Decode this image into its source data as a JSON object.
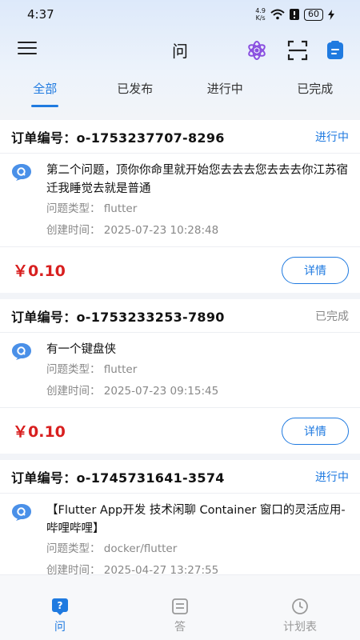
{
  "status_bar": {
    "time": "4:37",
    "net_speed_value": "4.9",
    "net_speed_unit": "K/s",
    "battery": "60"
  },
  "header": {
    "title": "问"
  },
  "tabs": [
    {
      "label": "全部",
      "active": true
    },
    {
      "label": "已发布",
      "active": false
    },
    {
      "label": "进行中",
      "active": false
    },
    {
      "label": "已完成",
      "active": false
    }
  ],
  "orders": [
    {
      "order_label": "订单编号：o-1753237707-8296",
      "status": "进行中",
      "title": "第二个问题，顶你你命里就开始您去去去您去去去你江苏宿迁我睡觉去就是普通",
      "type": "问题类型：  flutter",
      "created": "创建时间：  2025-07-23 10:28:48",
      "price": "￥0.10",
      "detail_label": "详情"
    },
    {
      "order_label": "订单编号：o-1753233253-7890",
      "status": "已完成",
      "title": "有一个键盘侠",
      "type": "问题类型：  flutter",
      "created": "创建时间：  2025-07-23 09:15:45",
      "price": "￥0.10",
      "detail_label": "详情"
    },
    {
      "order_label": "订单编号：o-1745731641-3574",
      "status": "进行中",
      "title": "【Flutter App开发 技术闲聊 Container 窗口的灵活应用-哔哩哔哩】",
      "type": "问题类型：  docker/flutter",
      "created": "创建时间：  2025-04-27 13:27:55",
      "price": "",
      "detail_label": ""
    }
  ],
  "bottom_nav": [
    {
      "label": "问",
      "icon": "question-icon",
      "active": true
    },
    {
      "label": "答",
      "icon": "answer-icon",
      "active": false
    },
    {
      "label": "计划表",
      "icon": "clock-icon",
      "active": false
    }
  ],
  "colors": {
    "accent": "#1f7ae0",
    "price": "#d81f1f",
    "muted": "#888888"
  }
}
